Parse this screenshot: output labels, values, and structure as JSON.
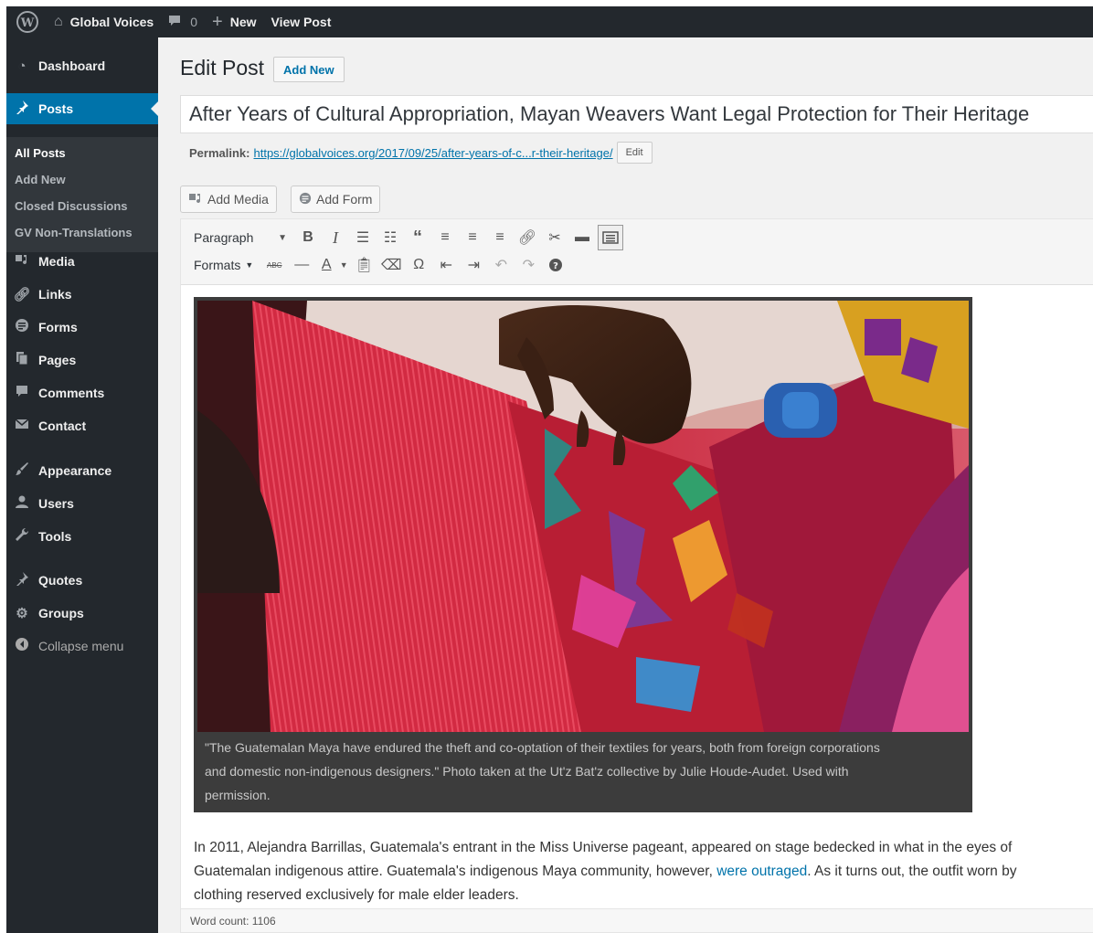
{
  "admin_bar": {
    "site_name": "Global Voices",
    "comments_count": "0",
    "new_label": "New",
    "view_post_label": "View Post"
  },
  "sidebar": {
    "items": [
      {
        "label": "Dashboard",
        "icon": "dashboard-icon"
      },
      {
        "label": "Posts",
        "icon": "pushpin-icon"
      },
      {
        "label": "Media",
        "icon": "media-icon"
      },
      {
        "label": "Links",
        "icon": "link-icon"
      },
      {
        "label": "Forms",
        "icon": "forms-icon"
      },
      {
        "label": "Pages",
        "icon": "pages-icon"
      },
      {
        "label": "Comments",
        "icon": "comment-icon"
      },
      {
        "label": "Contact",
        "icon": "mail-icon"
      },
      {
        "label": "Appearance",
        "icon": "brush-icon"
      },
      {
        "label": "Users",
        "icon": "user-icon"
      },
      {
        "label": "Tools",
        "icon": "wrench-icon"
      },
      {
        "label": "Quotes",
        "icon": "pushpin-icon"
      },
      {
        "label": "Groups",
        "icon": "gear-icon"
      },
      {
        "label": "Collapse menu",
        "icon": "collapse-icon"
      }
    ],
    "submenu": [
      "All Posts",
      "Add New",
      "Closed Discussions",
      "GV Non-Translations"
    ]
  },
  "header": {
    "title": "Edit Post",
    "add_new_label": "Add New"
  },
  "post": {
    "title": "After Years of Cultural Appropriation, Mayan Weavers Want Legal Protection for Their Heritage",
    "permalink_label": "Permalink:",
    "permalink_url": "https://globalvoices.org/2017/09/25/after-years-of-c...r-their-heritage/",
    "permalink_edit": "Edit"
  },
  "media_buttons": {
    "add_media": "Add Media",
    "add_form": "Add Form"
  },
  "toolbar": {
    "format_select": "Paragraph",
    "formats_label": "Formats"
  },
  "content": {
    "caption_lines": [
      "\"The Guatemalan Maya have endured the theft and co-optation of their textiles for years, both from foreign corporations",
      "and domestic non-indigenous designers.\" Photo taken at the Ut'z Bat'z collective by Julie Houde-Audet. Used with",
      "permission."
    ],
    "paragraph_line1": "In 2011, Alejandra Barrillas, Guatemala's entrant in the Miss Universe pageant, appeared on stage bedecked in what in the eyes of",
    "paragraph_line2_before": "Guatemalan indigenous attire. Guatemala's indigenous Maya community, however, ",
    "paragraph_link": "were outraged",
    "paragraph_line2_after": ". As it turns out, the outfit worn by",
    "paragraph_line3": "clothing reserved exclusively for male elder leaders."
  },
  "status": {
    "word_count": "Word count: 1106"
  },
  "colors": {
    "admin_dark": "#23282d",
    "accent_blue": "#0073aa",
    "background": "#f1f1f1"
  }
}
